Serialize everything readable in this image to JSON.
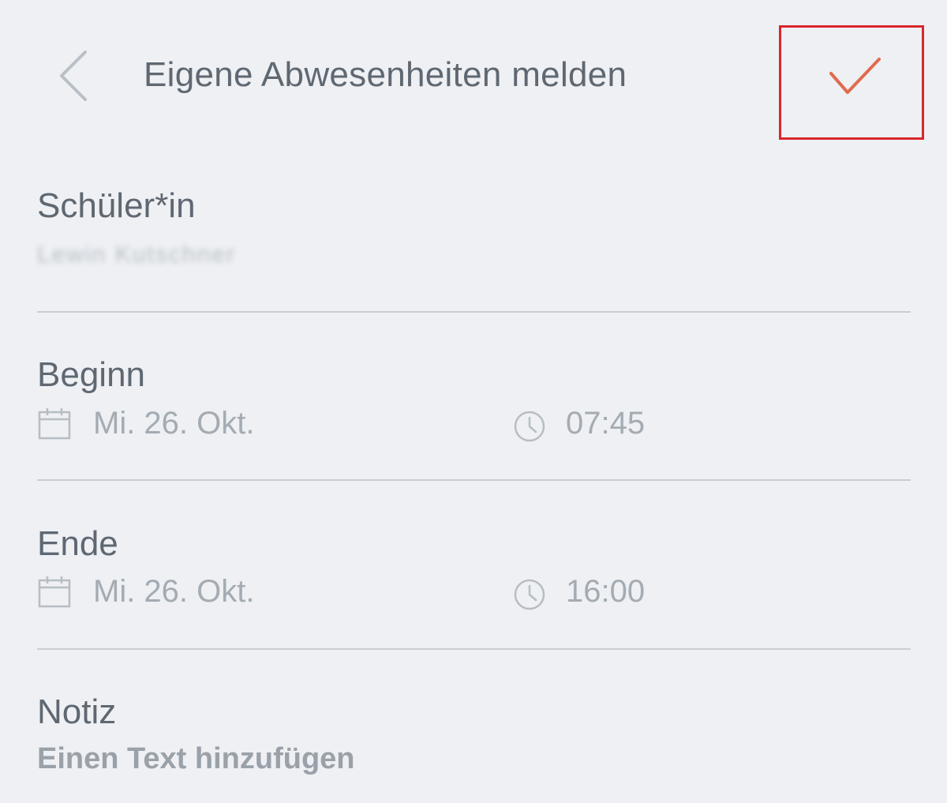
{
  "header": {
    "title": "Eigene Abwesenheiten melden",
    "back_icon": "chevron-left-icon",
    "confirm_icon": "checkmark-icon",
    "confirm_color": "#e06a4f",
    "highlight_color": "#d9262c"
  },
  "student": {
    "label": "Schüler*in",
    "name": "Lewin Kutschner"
  },
  "begin": {
    "label": "Beginn",
    "date": "Mi. 26. Okt.",
    "time": "07:45"
  },
  "end": {
    "label": "Ende",
    "date": "Mi. 26. Okt.",
    "time": "16:00"
  },
  "note": {
    "label": "Notiz",
    "placeholder": "Einen Text hinzufügen"
  }
}
